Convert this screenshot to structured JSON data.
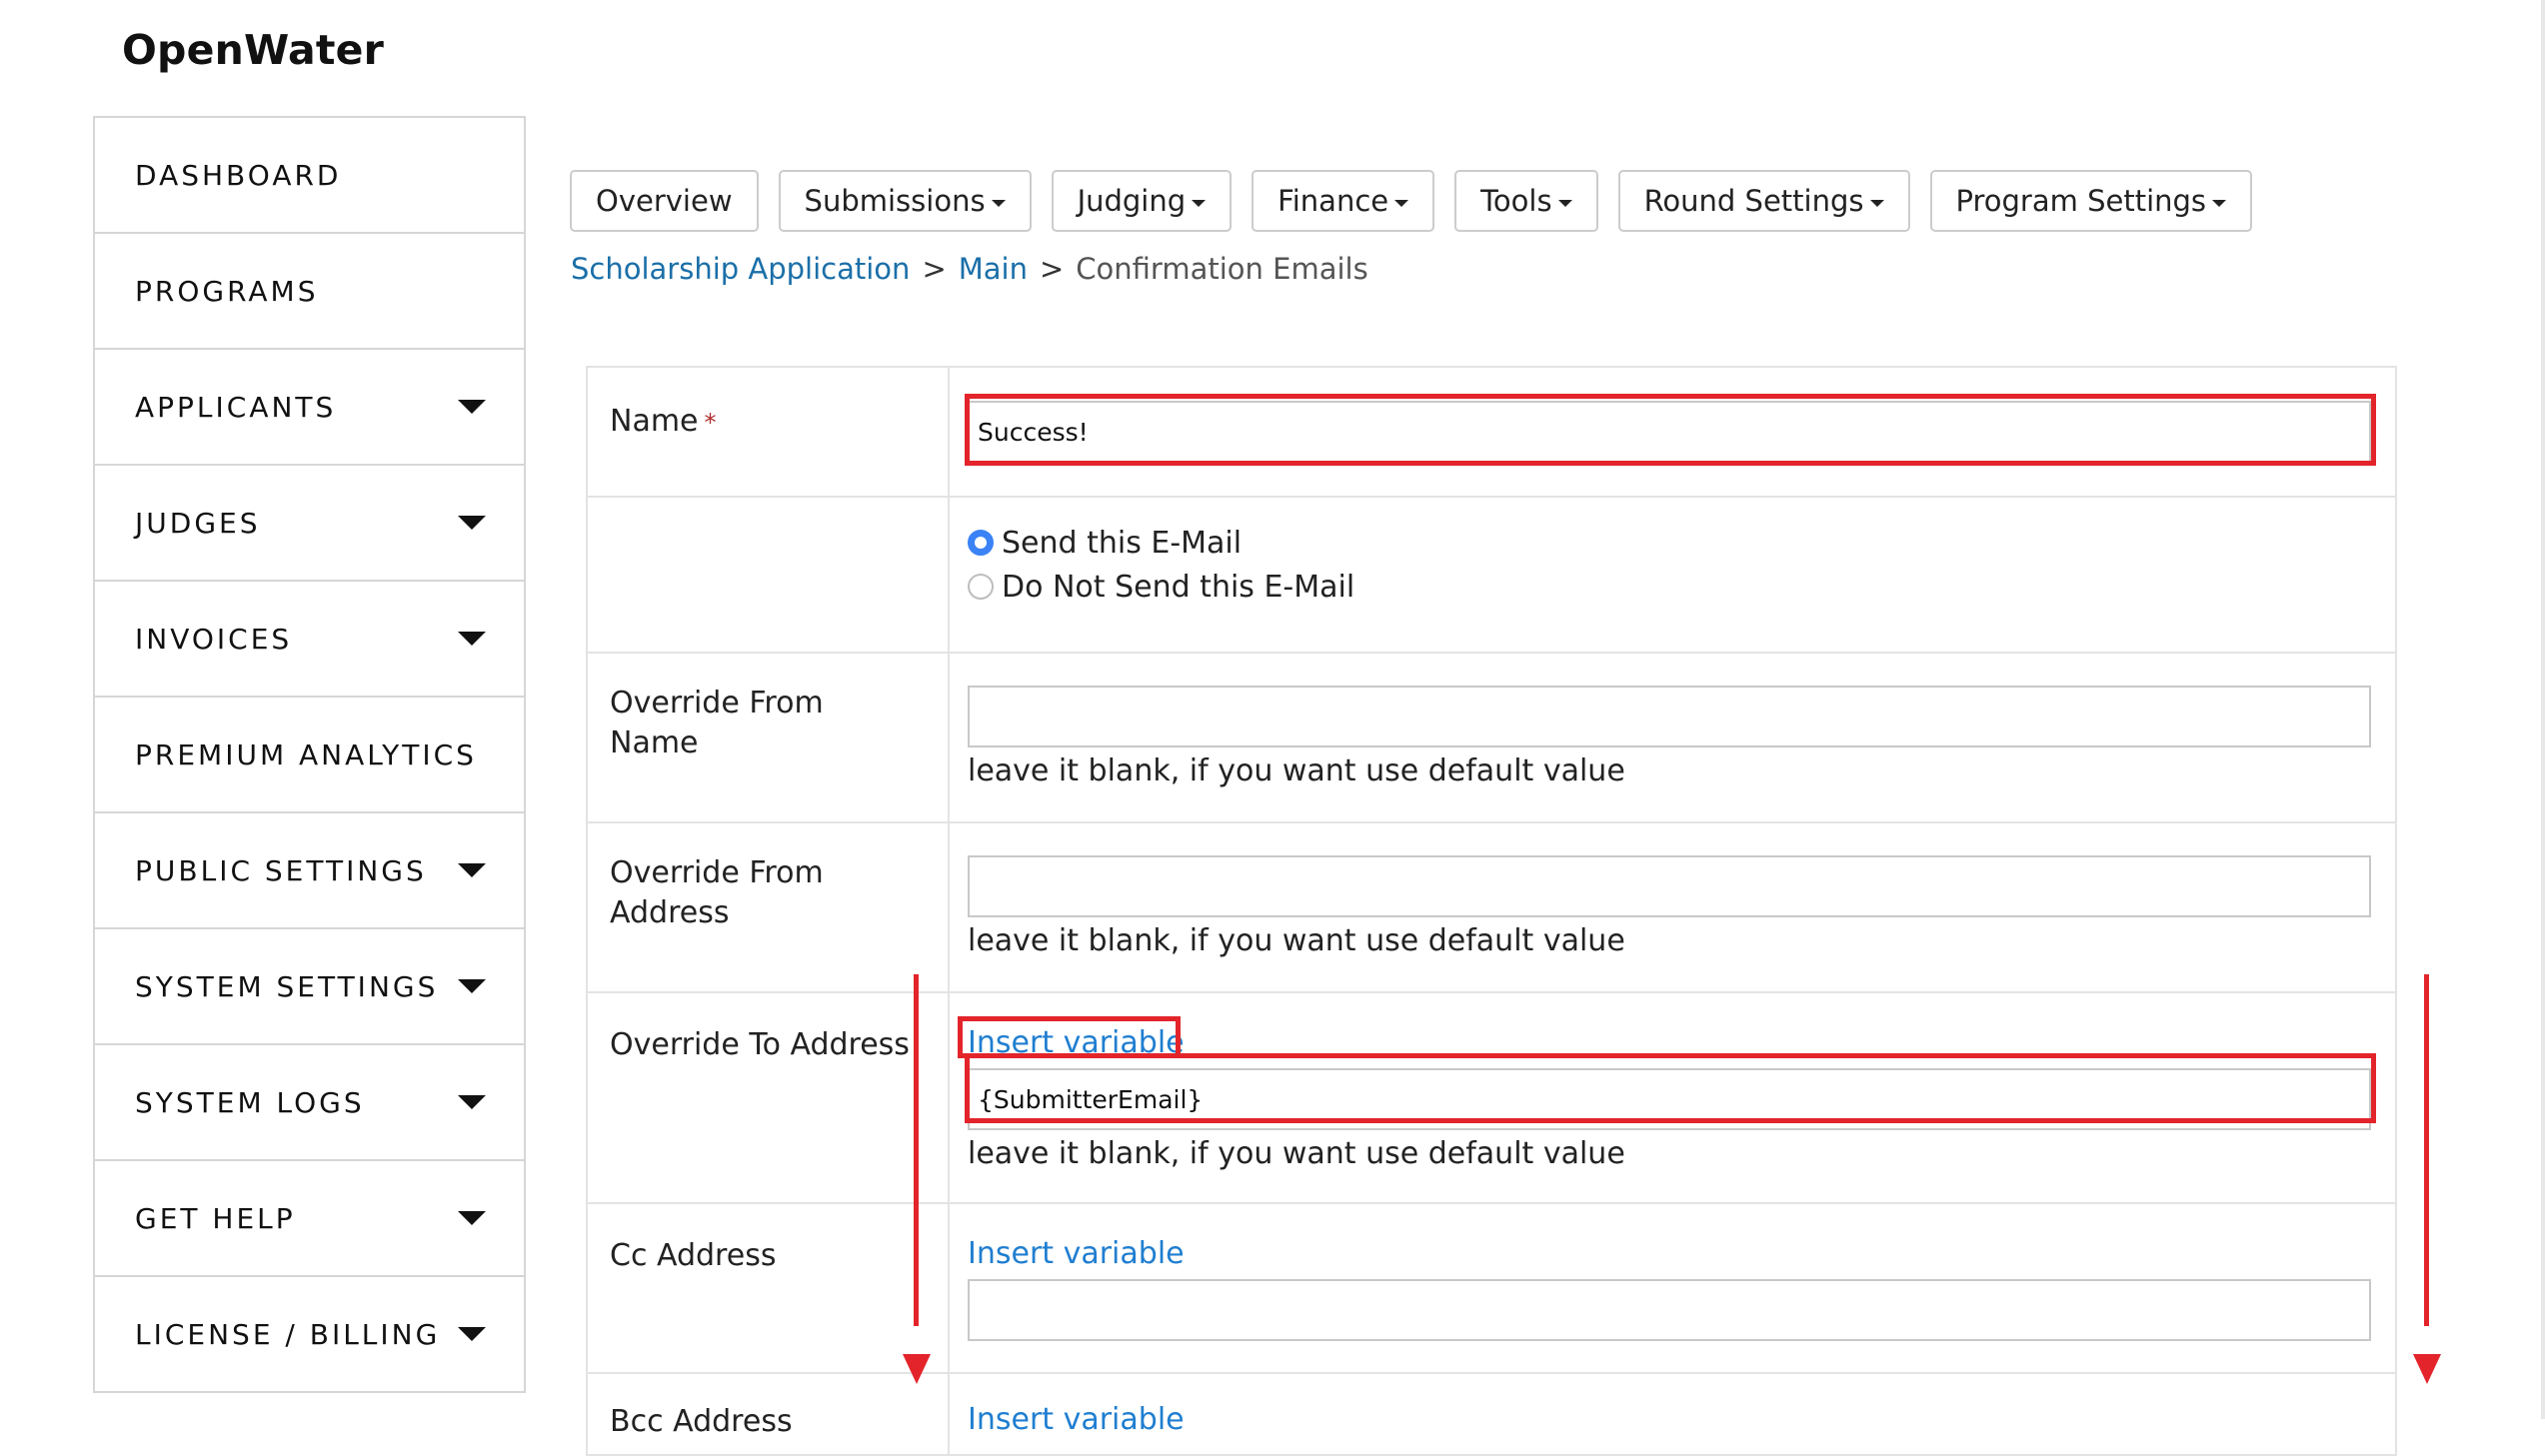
{
  "app": {
    "title": "OpenWater"
  },
  "sidebar": {
    "items": [
      {
        "label": "DASHBOARD",
        "has_caret": false
      },
      {
        "label": "PROGRAMS",
        "has_caret": false
      },
      {
        "label": "APPLICANTS",
        "has_caret": true
      },
      {
        "label": "JUDGES",
        "has_caret": true
      },
      {
        "label": "INVOICES",
        "has_caret": true
      },
      {
        "label": "PREMIUM ANALYTICS",
        "has_caret": false
      },
      {
        "label": "PUBLIC SETTINGS",
        "has_caret": true
      },
      {
        "label": "SYSTEM SETTINGS",
        "has_caret": true
      },
      {
        "label": "SYSTEM LOGS",
        "has_caret": true
      },
      {
        "label": "GET HELP",
        "has_caret": true
      },
      {
        "label": "LICENSE / BILLING",
        "has_caret": true
      }
    ]
  },
  "topnav": {
    "overview": "Overview",
    "submissions": "Submissions",
    "judging": "Judging",
    "finance": "Finance",
    "tools": "Tools",
    "round_settings": "Round Settings",
    "program_settings": "Program Settings"
  },
  "breadcrumb": {
    "item1": "Scholarship Application",
    "item2": "Main",
    "current": "Confirmation Emails",
    "separator": ">"
  },
  "form": {
    "name": {
      "label": "Name",
      "required_mark": "*",
      "value": "Success!"
    },
    "send_option": {
      "send_label": "Send this E-Mail",
      "no_send_label": "Do Not Send this E-Mail",
      "selected": "send"
    },
    "override_from_name": {
      "label_line1": "Override From",
      "label_line2": "Name",
      "value": "",
      "hint": "leave it blank, if you want use default value"
    },
    "override_from_address": {
      "label_line1": "Override From",
      "label_line2": "Address",
      "value": "",
      "hint": "leave it blank, if you want use default value"
    },
    "override_to_address": {
      "label": "Override To Address",
      "insert_link": "Insert variable",
      "value": "{SubmitterEmail}",
      "hint": "leave it blank, if you want use default value"
    },
    "cc_address": {
      "label": "Cc Address",
      "insert_link": "Insert variable",
      "value": ""
    },
    "bcc_address": {
      "label": "Bcc Address",
      "insert_link": "Insert variable"
    }
  },
  "colors": {
    "link": "#1f7ed0",
    "breadcrumb_link": "#1b6fa8",
    "annotation": "#e3242b",
    "radio_selected": "#3b82f6"
  }
}
